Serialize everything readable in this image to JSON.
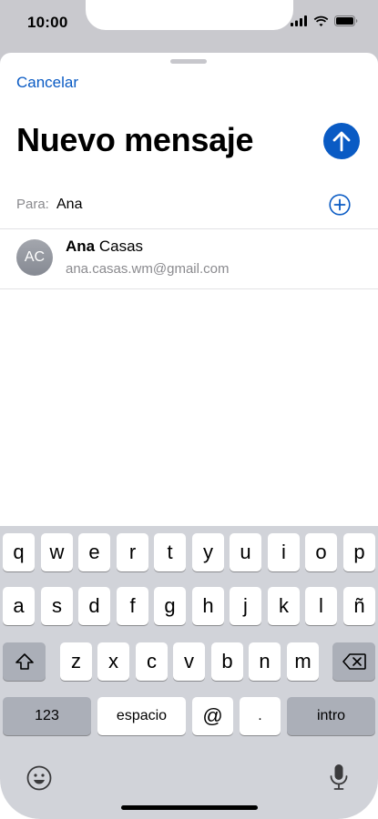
{
  "status": {
    "time": "10:00",
    "icons": [
      "signal-icon",
      "wifi-icon",
      "battery-icon"
    ]
  },
  "header": {
    "cancel_label": "Cancelar",
    "title": "Nuevo mensaje",
    "send_icon": "send-arrow-icon"
  },
  "recipients": {
    "to_label": "Para:",
    "to_value": "Ana",
    "add_icon": "add-contact-icon"
  },
  "suggestion": {
    "initials": "AC",
    "first_name": "Ana",
    "last_name": "Casas",
    "email": "ana.casas.wm@gmail.com"
  },
  "keyboard": {
    "row1": [
      "q",
      "w",
      "e",
      "r",
      "t",
      "y",
      "u",
      "i",
      "o",
      "p"
    ],
    "row2": [
      "a",
      "s",
      "d",
      "f",
      "g",
      "h",
      "j",
      "k",
      "l",
      "ñ"
    ],
    "row3": [
      "z",
      "x",
      "c",
      "v",
      "b",
      "n",
      "m"
    ],
    "numbers_label": "123",
    "space_label": "espacio",
    "at_label": "@",
    "dot_label": ".",
    "return_label": "intro",
    "icons": [
      "shift-icon",
      "delete-icon",
      "emoji-icon",
      "microphone-icon"
    ]
  },
  "colors": {
    "accent": "#0a5bc4",
    "keyboard_bg": "#d1d3d9",
    "dark_key": "#abafb8"
  }
}
